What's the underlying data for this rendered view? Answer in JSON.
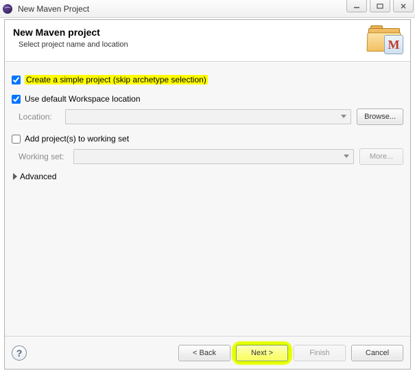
{
  "window": {
    "title": "New Maven Project"
  },
  "banner": {
    "title": "New Maven project",
    "subtitle": "Select project name and location"
  },
  "options": {
    "simple_project": {
      "checked": true,
      "label": "Create a simple project (skip archetype selection)"
    },
    "default_location": {
      "checked": true,
      "label": "Use default Workspace location"
    },
    "location_label": "Location:",
    "browse_label": "Browse...",
    "add_to_working_set": {
      "checked": false,
      "label": "Add project(s) to working set"
    },
    "working_set_label": "Working set:",
    "more_label": "More...",
    "advanced_label": "Advanced"
  },
  "footer": {
    "back": "< Back",
    "next": "Next >",
    "finish": "Finish",
    "cancel": "Cancel"
  },
  "win": {
    "min": "minimize",
    "max": "maximize",
    "close": "close"
  }
}
